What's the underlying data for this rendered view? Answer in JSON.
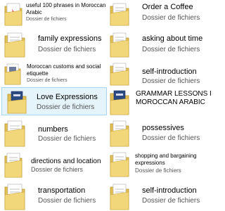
{
  "items": [
    {
      "name": "useful 100 phrases in Moroccan",
      "name2": "Arabic",
      "type": "Dossier de fichiers"
    },
    {
      "name": "Order a Coffee",
      "name2": "",
      "type": "Dossier de fichiers"
    },
    {
      "name": "family expressions",
      "name2": "",
      "type": "Dossier de fichiers"
    },
    {
      "name": "asking about time",
      "name2": "",
      "type": "Dossier de fichiers"
    },
    {
      "name": "Moroccan customs and social",
      "name2": "etiquette",
      "type": "Dossier de fichiers"
    },
    {
      "name": "self-introduction",
      "name2": "",
      "type": "Dossier de fichiers"
    },
    {
      "name": "Love Expressions",
      "name2": "",
      "type": "Dossier de fichiers"
    },
    {
      "name": "GRAMMAR LESSONS IN",
      "name2": "MOROCCAN ARABIC",
      "type": ""
    },
    {
      "name": "numbers",
      "name2": "",
      "type": "Dossier de fichiers"
    },
    {
      "name": "possessives",
      "name2": "",
      "type": "Dossier de fichiers"
    },
    {
      "name": "directions and location",
      "name2": "",
      "type": "Dossier de fichiers"
    },
    {
      "name": "shopping and bargaining",
      "name2": "expressions",
      "type": "Dossier de fichiers"
    },
    {
      "name": "transportation",
      "name2": "",
      "type": "Dossier de fichiers"
    },
    {
      "name": "self-introduction",
      "name2": "",
      "type": "Dossier de fichiers"
    }
  ],
  "colors": {
    "selection_bg": "#e5f3fb",
    "selection_border": "#a9d5f0",
    "folder": "#e9c95c",
    "pdf": "#d8242c"
  },
  "icons": [
    "folder-icon",
    "pdf-document-icon",
    "book-icon"
  ]
}
